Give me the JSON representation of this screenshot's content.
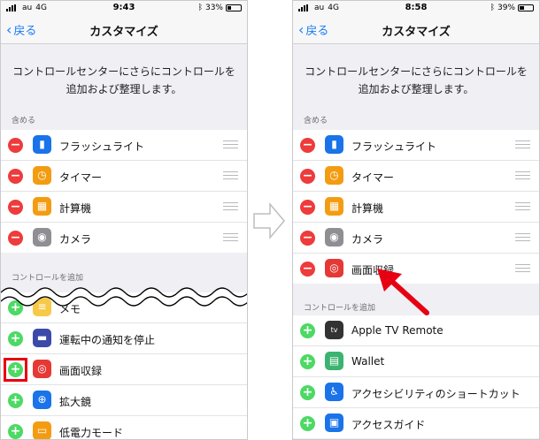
{
  "left": {
    "status": {
      "carrier": "au",
      "network": "4G",
      "time": "9:43",
      "battery": "33%",
      "battery_level": 0.33
    },
    "nav": {
      "back": "戻る",
      "title": "カスタマイズ"
    },
    "description": "コントロールセンターにさらにコントロールを追加および整理します。",
    "include_header": "含める",
    "include_items": [
      {
        "label": "フラッシュライト",
        "icon": "flashlight-icon",
        "color": "#1a73e8"
      },
      {
        "label": "タイマー",
        "icon": "timer-icon",
        "color": "#f39c12"
      },
      {
        "label": "計算機",
        "icon": "calculator-icon",
        "color": "#f39c12"
      },
      {
        "label": "カメラ",
        "icon": "camera-icon",
        "color": "#8e8e93"
      }
    ],
    "add_header": "コントロールを追加",
    "add_items": [
      {
        "label": "メモ",
        "icon": "notes-icon",
        "color": "#f7c948"
      },
      {
        "label": "運転中の通知を停止",
        "icon": "car-icon",
        "color": "#3b4aa8"
      },
      {
        "label": "画面収録",
        "icon": "screen-record-icon",
        "color": "#e53935"
      },
      {
        "label": "拡大鏡",
        "icon": "magnifier-icon",
        "color": "#1a73e8"
      },
      {
        "label": "低電力モード",
        "icon": "battery-icon",
        "color": "#f39c12"
      }
    ]
  },
  "right": {
    "status": {
      "carrier": "au",
      "network": "4G",
      "time": "8:58",
      "battery": "39%",
      "battery_level": 0.39
    },
    "nav": {
      "back": "戻る",
      "title": "カスタマイズ"
    },
    "description": "コントロールセンターにさらにコントロールを追加および整理します。",
    "include_header": "含める",
    "include_items": [
      {
        "label": "フラッシュライト",
        "icon": "flashlight-icon",
        "color": "#1a73e8"
      },
      {
        "label": "タイマー",
        "icon": "timer-icon",
        "color": "#f39c12"
      },
      {
        "label": "計算機",
        "icon": "calculator-icon",
        "color": "#f39c12"
      },
      {
        "label": "カメラ",
        "icon": "camera-icon",
        "color": "#8e8e93"
      },
      {
        "label": "画面収録",
        "icon": "screen-record-icon",
        "color": "#e53935"
      }
    ],
    "add_header": "コントロールを追加",
    "add_items": [
      {
        "label": "Apple TV Remote",
        "icon": "apple-tv-icon",
        "color": "#333333"
      },
      {
        "label": "Wallet",
        "icon": "wallet-icon",
        "color": "#3cb371"
      },
      {
        "label": "アクセシビリティのショートカット",
        "icon": "accessibility-icon",
        "color": "#1a73e8"
      },
      {
        "label": "アクセスガイド",
        "icon": "lock-icon",
        "color": "#1a73e8"
      }
    ]
  },
  "accents": {
    "link": "#1a7cf5",
    "remove": "#ee3b3b",
    "add": "#4cd964",
    "annotation": "#e60012"
  }
}
